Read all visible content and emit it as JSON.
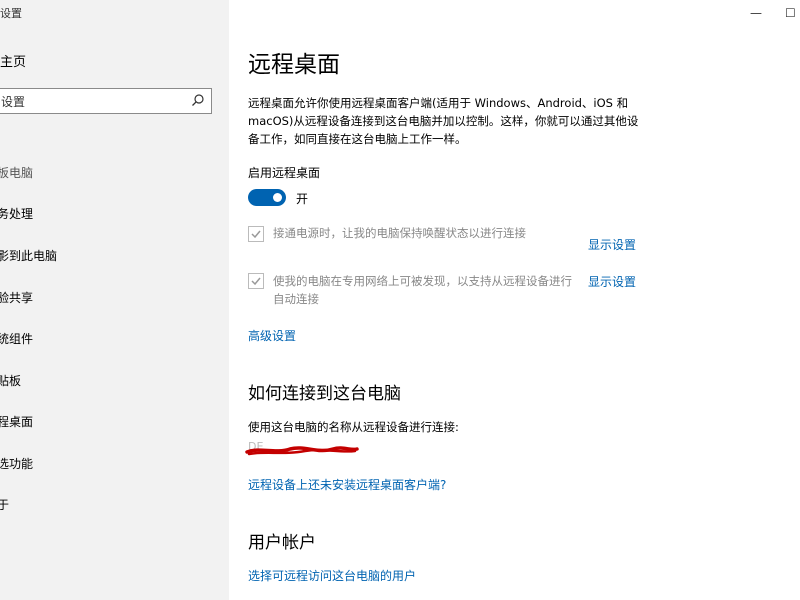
{
  "sidebar": {
    "app_title": "设置",
    "home_label": "主页",
    "search_placeholder": "设置",
    "items": [
      {
        "label": "板电脑"
      },
      {
        "label": "务处理"
      },
      {
        "label": "影到此电脑"
      },
      {
        "label": "验共享"
      },
      {
        "label": "统组件"
      },
      {
        "label": "贴板"
      },
      {
        "label": "程桌面"
      },
      {
        "label": "选功能"
      },
      {
        "label": "于"
      }
    ]
  },
  "window": {
    "minimize_glyph": "—",
    "maximize_glyph": "☐"
  },
  "main": {
    "title": "远程桌面",
    "description": "远程桌面允许你使用远程桌面客户端(适用于 Windows、Android、iOS 和 macOS)从远程设备连接到这台电脑并加以控制。这样，你就可以通过其他设备工作，如同直接在这台电脑上工作一样。",
    "enable_label": "启用远程桌面",
    "toggle_state": "开",
    "option1_text": "接通电源时，让我的电脑保持唤醒状态以进行连接",
    "option1_link": "显示设置",
    "option2_text": "使我的电脑在专用网络上可被发现，以支持从远程设备进行自动连接",
    "option2_link": "显示设置",
    "advanced_link": "高级设置",
    "connect_heading": "如何连接到这台电脑",
    "connect_desc": "使用这台电脑的名称从远程设备进行连接:",
    "pc_name": "DE",
    "no_client_link": "远程设备上还未安装远程桌面客户端?",
    "accounts_heading": "用户帐户",
    "accounts_link": "选择可远程访问这台电脑的用户"
  },
  "colors": {
    "accent": "#0063b1",
    "sidebar_bg": "#f2f2f2",
    "scribble": "#c40000"
  }
}
